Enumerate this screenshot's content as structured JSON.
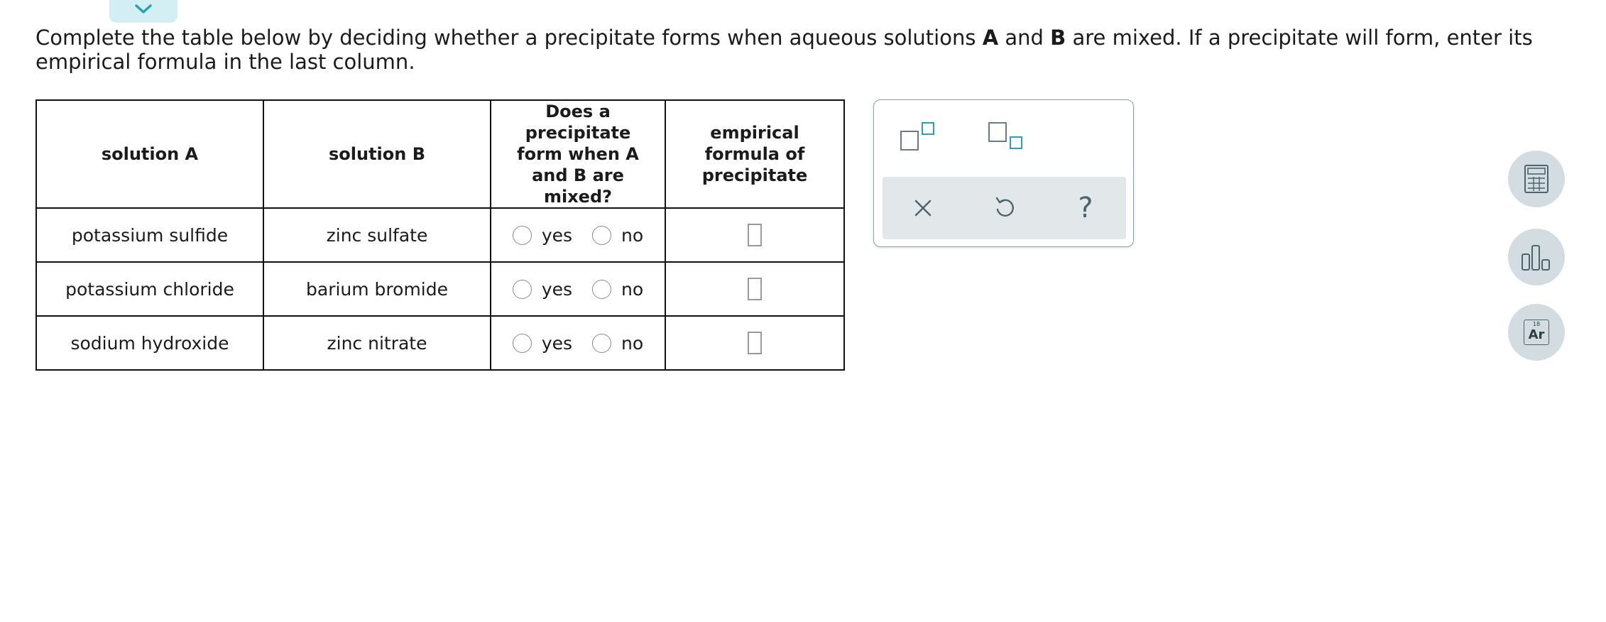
{
  "instructions": {
    "part1": "Complete the table below by deciding whether a precipitate forms when aqueous solutions ",
    "a": "A",
    "part2": " and ",
    "b": "B",
    "part3": " are mixed. If a precipitate will form, enter its empirical formula in the last column."
  },
  "table": {
    "headers": {
      "solution_a": "solution A",
      "solution_b": "solution B",
      "precipitate_q": "Does a precipitate form when A and B are mixed?",
      "formula": "empirical formula of precipitate"
    },
    "rows": [
      {
        "solution_a": "potassium sulfide",
        "solution_b": "zinc sulfate",
        "yes": "yes",
        "no": "no"
      },
      {
        "solution_a": "potassium chloride",
        "solution_b": "barium bromide",
        "yes": "yes",
        "no": "no"
      },
      {
        "solution_a": "sodium hydroxide",
        "solution_b": "zinc nitrate",
        "yes": "yes",
        "no": "no"
      }
    ]
  },
  "palette": {
    "buttons": [
      "superscript-icon",
      "subscript-icon"
    ],
    "actions": [
      "clear-icon",
      "undo-icon",
      "help-icon"
    ],
    "help_glyph": "?"
  },
  "side_tools": {
    "calculator": "calculator-icon",
    "data": "bar-chart-icon",
    "periodic_table": {
      "number": "18",
      "symbol": "Ar"
    }
  },
  "colors": {
    "accent": "#2aa0b8",
    "tab_bg": "#d3eff4",
    "icon_gray": "#4d6470",
    "tool_bg": "#d3dde1"
  }
}
